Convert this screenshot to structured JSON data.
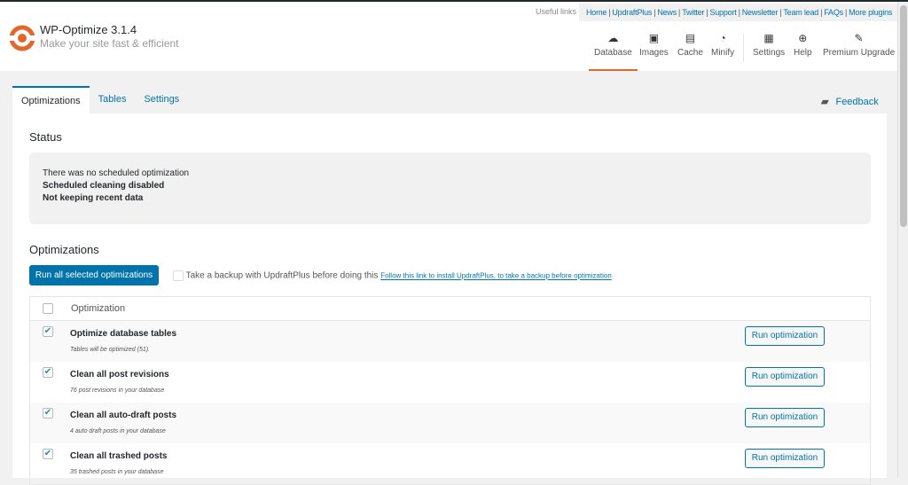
{
  "header": {
    "title": "WP-Optimize 3.1.4",
    "tagline": "Make your site fast & efficient",
    "useful_links_label": "Useful links",
    "links": [
      "Home",
      "UpdraftPlus",
      "News",
      "Twitter",
      "Support",
      "Newsletter",
      "Team lead",
      "FAQs",
      "More plugins"
    ],
    "nav": [
      {
        "label": "Database",
        "icon": "cloud-icon",
        "active": true
      },
      {
        "label": "Images",
        "icon": "images-icon"
      },
      {
        "label": "Cache",
        "icon": "archive-icon"
      },
      {
        "label": "Minify",
        "icon": "dashboard-icon"
      },
      {
        "label": "Settings",
        "icon": "settings-icon"
      },
      {
        "label": "Help",
        "icon": "lifebuoy-icon"
      },
      {
        "label": "Premium Upgrade",
        "icon": "plug-icon"
      }
    ]
  },
  "accent": "#0073aa",
  "brand": "#e2672c",
  "tabs": [
    "Optimizations",
    "Tables",
    "Settings"
  ],
  "feedback": "Feedback",
  "status": {
    "heading": "Status",
    "lines": [
      "There was no scheduled optimization",
      "Scheduled cleaning disabled",
      "Not keeping recent data"
    ]
  },
  "optimizations": {
    "heading": "Optimizations",
    "run_all": "Run all selected optimizations",
    "backup_label": "Take a backup with UpdraftPlus before doing this",
    "backup_link": "Follow this link to install UpdraftPlus, to take a backup before optimization",
    "column": "Optimization",
    "rows": [
      {
        "name": "Optimize database tables",
        "sub": "Tables will be optimized (51).",
        "checked": true,
        "button": "Run optimization"
      },
      {
        "name": "Clean all post revisions",
        "sub": "76 post revisions in your database",
        "checked": true,
        "button": "Run optimization"
      },
      {
        "name": "Clean all auto-draft posts",
        "sub": "4 auto draft posts in your database",
        "checked": true,
        "button": "Run optimization"
      },
      {
        "name": "Clean all trashed posts",
        "sub": "35 trashed posts in your database",
        "checked": true,
        "button": "Run optimization"
      }
    ]
  }
}
